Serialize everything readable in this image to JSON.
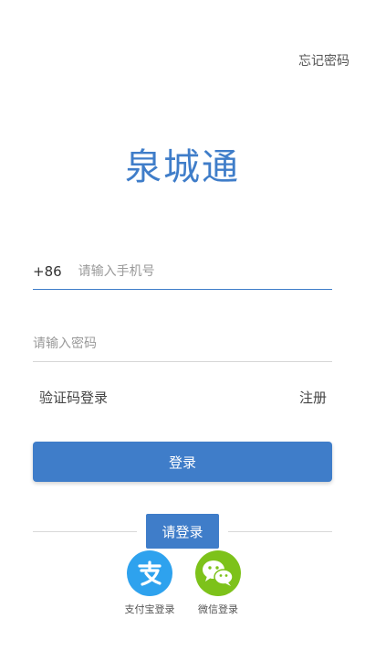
{
  "header": {
    "forgot_password": "忘记密码"
  },
  "app": {
    "title": "泉城通"
  },
  "form": {
    "country_code": "+86",
    "phone_placeholder": "请输入手机号",
    "phone_value": "",
    "password_placeholder": "请输入密码",
    "password_value": "",
    "sms_login": "验证码登录",
    "register": "注册",
    "login_button": "登录"
  },
  "third_party": {
    "section_label": "请登录",
    "alipay_label": "支付宝登录",
    "wechat_label": "微信登录"
  },
  "colors": {
    "accent": "#3f7dc9",
    "alipay": "#2ea2ee",
    "wechat": "#7dc21a"
  },
  "icons": {
    "alipay": "alipay-icon",
    "wechat": "wechat-icon"
  }
}
